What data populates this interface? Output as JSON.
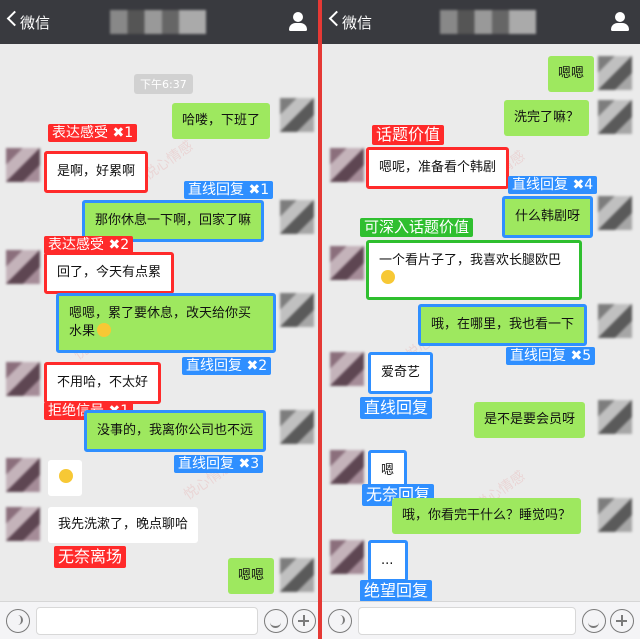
{
  "left": {
    "header": {
      "back_label": "微信"
    },
    "time_chip": "下午6:37",
    "messages": [
      {
        "text": "哈喽，下班了"
      },
      {
        "text": "是啊，好累啊"
      },
      {
        "text": "那你休息一下啊，回家了嘛"
      },
      {
        "text": "回了，今天有点累"
      },
      {
        "text": "嗯嗯，累了要休息，改天给你买水果"
      },
      {
        "text": "不用哈，不太好"
      },
      {
        "text": "没事的，我离你公司也不远"
      },
      {
        "text": ""
      },
      {
        "text": "我先洗漱了，晚点聊哈"
      },
      {
        "text": "嗯嗯"
      }
    ],
    "tags": [
      {
        "text": "表达感受",
        "count": "1"
      },
      {
        "text": "直线回复",
        "count": "1"
      },
      {
        "text": "表达感受",
        "count": "2"
      },
      {
        "text": "直线回复",
        "count": "2"
      },
      {
        "text": "拒绝信号",
        "count": "1"
      },
      {
        "text": "直线回复",
        "count": "3"
      },
      {
        "text": "无奈离场",
        "count": ""
      }
    ]
  },
  "right": {
    "header": {
      "back_label": "微信"
    },
    "messages": [
      {
        "text": "嗯嗯"
      },
      {
        "text": "洗完了嘛？"
      },
      {
        "text": "嗯呢，准备看个韩剧"
      },
      {
        "text": "什么韩剧呀"
      },
      {
        "text": "一个看片子了，我喜欢长腿欧巴"
      },
      {
        "text": "哦，在哪里，我也看一下"
      },
      {
        "text": "爱奇艺"
      },
      {
        "text": "是不是要会员呀"
      },
      {
        "text": "嗯"
      },
      {
        "text": "哦，你看完干什么？睡觉吗？"
      },
      {
        "text": "..."
      }
    ],
    "tags": [
      {
        "text": "话题价值",
        "count": ""
      },
      {
        "text": "直线回复",
        "count": "4"
      },
      {
        "text": "可深入话题价值",
        "count": ""
      },
      {
        "text": "直线回复",
        "count": "5"
      },
      {
        "text": "直线回复",
        "count": ""
      },
      {
        "text": "无奈回复",
        "count": ""
      },
      {
        "text": "绝望回复",
        "count": ""
      }
    ]
  },
  "watermark": "悦心情感",
  "multiplier_symbol": "✖",
  "icons": [
    "chevron-left-icon",
    "person-icon",
    "voice-icon",
    "smile-icon",
    "plus-icon",
    "emoji-icon"
  ],
  "colors": {
    "header": "#393a3f",
    "chat_bg": "#ebebeb",
    "bubble_out": "#9ee85f",
    "bubble_in": "#ffffff",
    "tag_red": "#ff2a2a",
    "tag_blue": "#2f8fff",
    "tag_green": "#2fbf2f",
    "divider": "#e53935"
  }
}
